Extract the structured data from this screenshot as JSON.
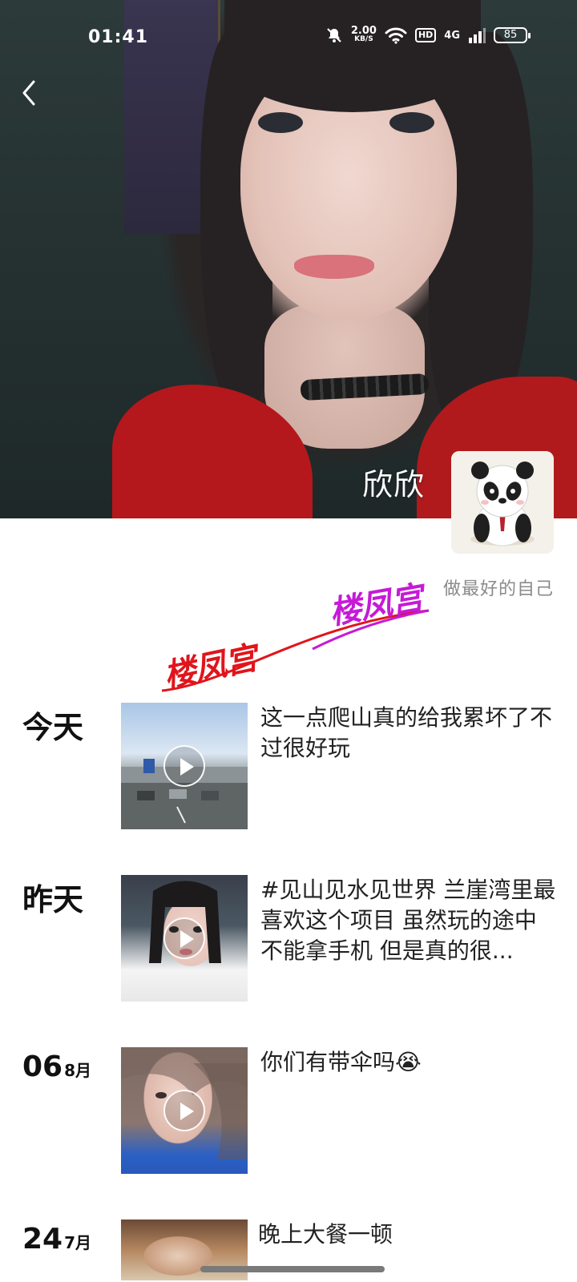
{
  "status_bar": {
    "time": "01:41",
    "net_speed_value": "2.00",
    "net_speed_unit": "KB/S",
    "hd_label": "HD",
    "signal_label": "4G",
    "battery": "85"
  },
  "profile": {
    "name": "欣欣",
    "signature": "做最好的自己",
    "decor_text_1": "楼凤宫",
    "decor_text_2": "楼凤宫",
    "decor_color_1": "#e0151b",
    "decor_color_2": "#c61ad6"
  },
  "feed": [
    {
      "date": "今天",
      "has_video": true,
      "caption": "这一点爬山真的给我累坏了不过很好玩"
    },
    {
      "date": "昨天",
      "has_video": true,
      "caption": "#见山见水见世界 兰崖湾里最喜欢这个项目 虽然玩的途中不能拿手机 但是真的很..."
    },
    {
      "day": "06",
      "month": "8月",
      "has_video": true,
      "caption": "你们有带伞吗😭"
    },
    {
      "day": "24",
      "month": "7月",
      "has_video": false,
      "caption": "晚上大餐一顿"
    }
  ],
  "icons": [
    "back-chevron-icon",
    "mute-bell-icon",
    "wifi-icon",
    "battery-icon",
    "play-icon"
  ]
}
